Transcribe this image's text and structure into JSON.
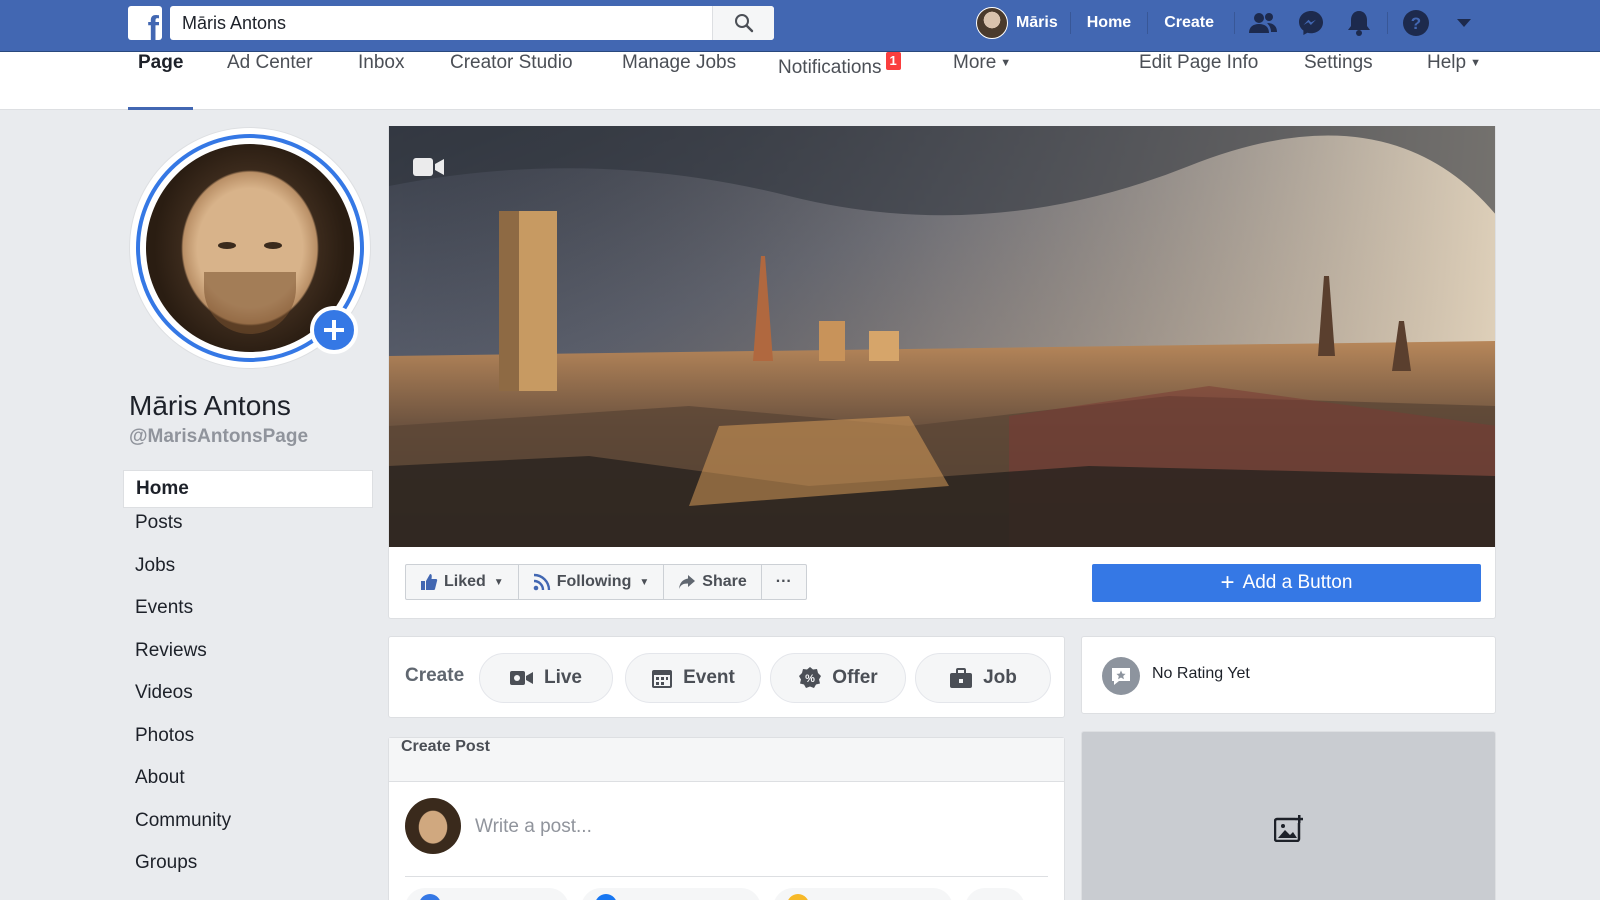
{
  "topbar": {
    "logo": "f",
    "search_value": "Māris Antons",
    "user_name": "Māris",
    "links": [
      "Home",
      "Create"
    ],
    "icons": [
      "friends-icon",
      "messenger-icon",
      "bell-icon",
      "help-icon",
      "caret-down-icon"
    ],
    "brand_color": "#4267b2"
  },
  "pagenav": {
    "left": [
      "Page",
      "Ad Center",
      "Inbox",
      "Creator Studio",
      "Manage Jobs",
      "Notifications",
      "More"
    ],
    "notifications_badge": "1",
    "right": [
      "Edit Page Info",
      "Settings",
      "Help"
    ]
  },
  "profile": {
    "name": "Māris Antons",
    "handle": "@MarisAntonsPage"
  },
  "leftnav": [
    "Home",
    "Posts",
    "Jobs",
    "Events",
    "Reviews",
    "Videos",
    "Photos",
    "About",
    "Community",
    "Groups"
  ],
  "actions": {
    "liked": "Liked",
    "following": "Following",
    "share": "Share",
    "more": "···",
    "add_button": "Add a Button",
    "accent": "#3578e5"
  },
  "create": {
    "label": "Create",
    "items": [
      "Live",
      "Event",
      "Offer",
      "Job"
    ]
  },
  "rating": {
    "text": "No Rating Yet"
  },
  "post": {
    "title": "Create Post",
    "placeholder": "Write a post..."
  }
}
